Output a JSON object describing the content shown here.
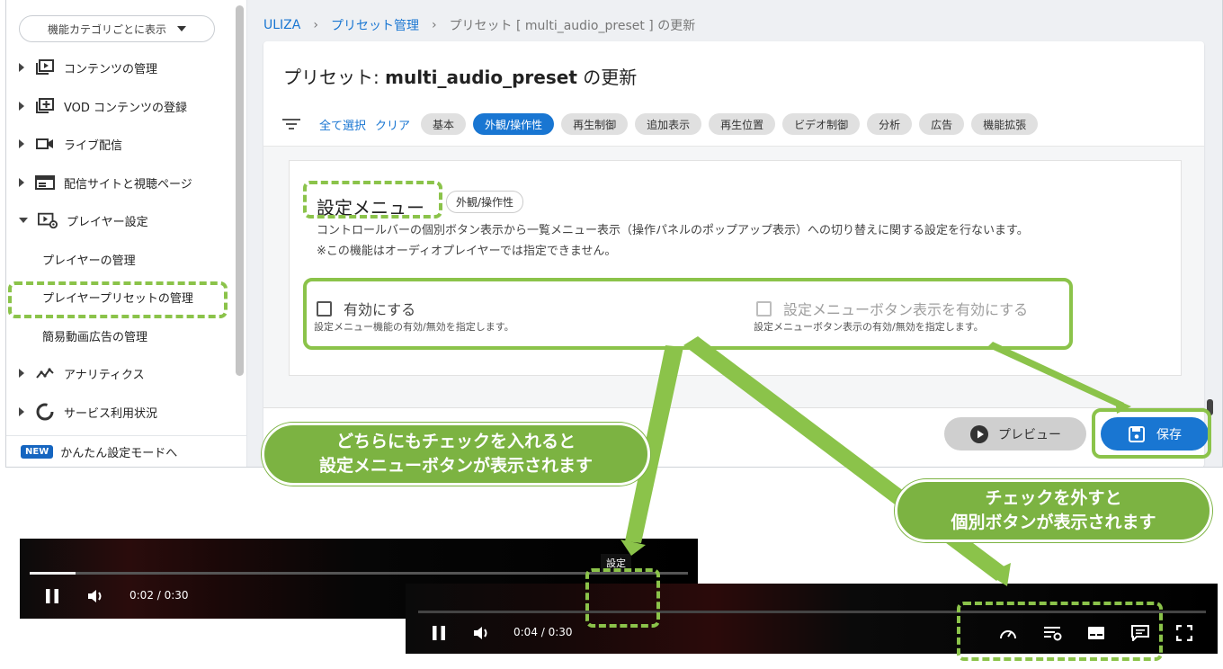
{
  "sidebar": {
    "category_select": "機能カテゴリごとに表示",
    "items": [
      {
        "label": "コンテンツの管理"
      },
      {
        "label": "VOD コンテンツの登録"
      },
      {
        "label": "ライブ配信"
      },
      {
        "label": "配信サイトと視聴ページ"
      },
      {
        "label": "プレイヤー設定"
      },
      {
        "label": "アナリティクス"
      },
      {
        "label": "サービス利用状況"
      }
    ],
    "sub_items": [
      "プレイヤーの管理",
      "プレイヤープリセットの管理",
      "簡易動画広告の管理"
    ],
    "new_badge": "NEW",
    "easy_mode": "かんたん設定モードへ"
  },
  "breadcrumb": {
    "root": "ULIZA",
    "sep": "›",
    "preset_mgmt": "プリセット管理",
    "current": "プリセット [ multi_audio_preset ] の更新"
  },
  "page": {
    "title_prefix": "プリセット: ",
    "title_name": "multi_audio_preset",
    "title_suffix": " の更新"
  },
  "filters": {
    "select_all": "全て選択",
    "clear": "クリア",
    "chips": [
      "基本",
      "外観/操作性",
      "再生制御",
      "追加表示",
      "再生位置",
      "ビデオ制御",
      "分析",
      "広告",
      "機能拡張"
    ],
    "active_index": 1
  },
  "section": {
    "title": "設定メニュー",
    "badge": "外観/操作性",
    "desc1": "コントロールバーの個別ボタン表示から一覧メニュー表示（操作パネルのポップアップ表示）への切り替えに関する設定を行ないます。",
    "desc2": "※この機能はオーディオプレイヤーでは指定できません。",
    "opt1_label": "有効にする",
    "opt1_hint": "設定メニュー機能の有効/無効を指定します。",
    "opt2_label": "設定メニューボタン表示を有効にする",
    "opt2_hint": "設定メニューボタン表示の有効/無効を指定します。"
  },
  "buttons": {
    "preview": "プレビュー",
    "save": "保存"
  },
  "annotations": {
    "bubble1_line1": "どちらにもチェックを入れると",
    "bubble1_line2": "設定メニューボタンが表示されます",
    "bubble2_line1": "チェックを外すと",
    "bubble2_line2": "個別ボタンが表示されます",
    "accent_color": "#8bc34a"
  },
  "player1": {
    "time": "0:02 / 0:30",
    "tooltip": "設定",
    "progress": 0.07
  },
  "player2": {
    "time": "0:04 / 0:30"
  },
  "colors": {
    "primary": "#1976d2",
    "chip": "#e0e0e0"
  }
}
